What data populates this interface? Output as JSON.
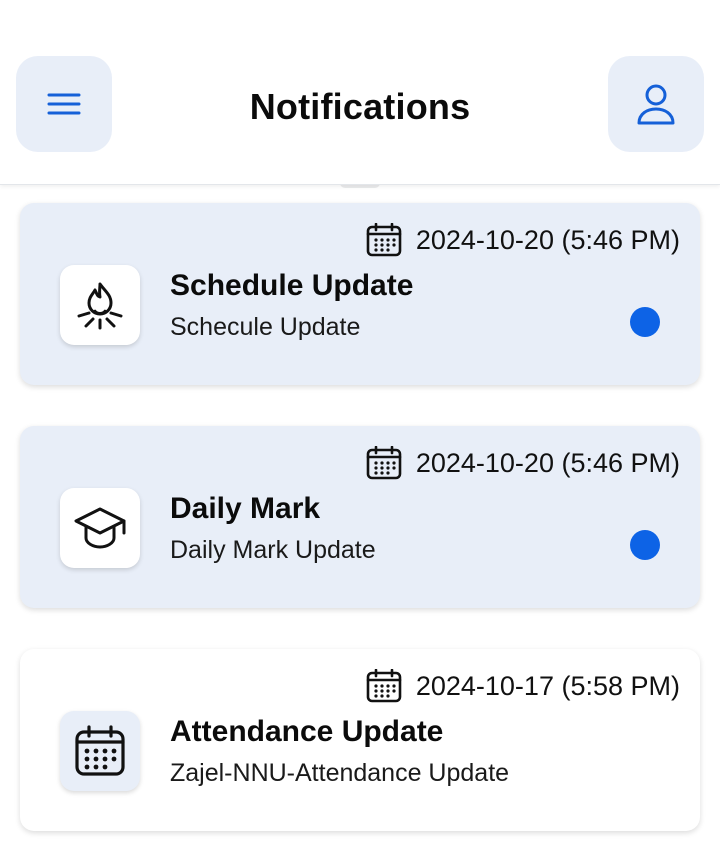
{
  "header": {
    "title": "Notifications",
    "menu_icon": "hamburger-menu-icon",
    "profile_icon": "user-profile-icon"
  },
  "colors": {
    "accent": "#0d63e6",
    "unread_bg": "#e8eef8",
    "read_bg": "#ffffff"
  },
  "notifications": [
    {
      "date": "2024-10-20 (5:46 PM)",
      "title": "Schedule Update",
      "subtitle": "Schecule Update",
      "icon": "campfire-icon",
      "unread": true
    },
    {
      "date": "2024-10-20 (5:46 PM)",
      "title": "Daily Mark",
      "subtitle": "Daily Mark Update",
      "icon": "graduation-cap-icon",
      "unread": true
    },
    {
      "date": "2024-10-17 (5:58 PM)",
      "title": "Attendance Update",
      "subtitle": "Zajel-NNU-Attendance Update",
      "icon": "calendar-icon",
      "unread": false
    }
  ]
}
